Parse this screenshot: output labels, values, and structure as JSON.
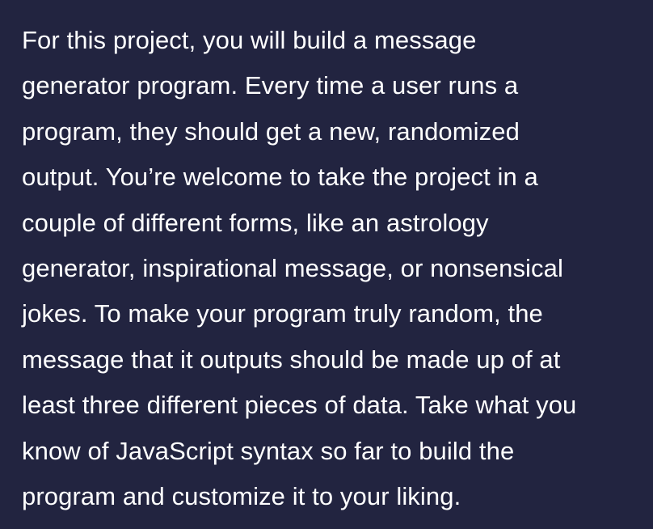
{
  "description": {
    "lines": [
      "For this project, you will build a message",
      "generator program. Every time a user runs a",
      "program, they should get a new, randomized",
      "output. You’re welcome to take the project in a",
      "couple of different forms, like an astrology",
      "generator, inspirational message, or nonsensical",
      "jokes. To make your program truly random, the",
      "message that it outputs should be made up of at",
      "least three different pieces of data. Take what you",
      "know of JavaScript syntax so far to build the",
      "program and customize it to your liking."
    ]
  },
  "colors": {
    "background": "#222440",
    "text": "#ffffff"
  }
}
